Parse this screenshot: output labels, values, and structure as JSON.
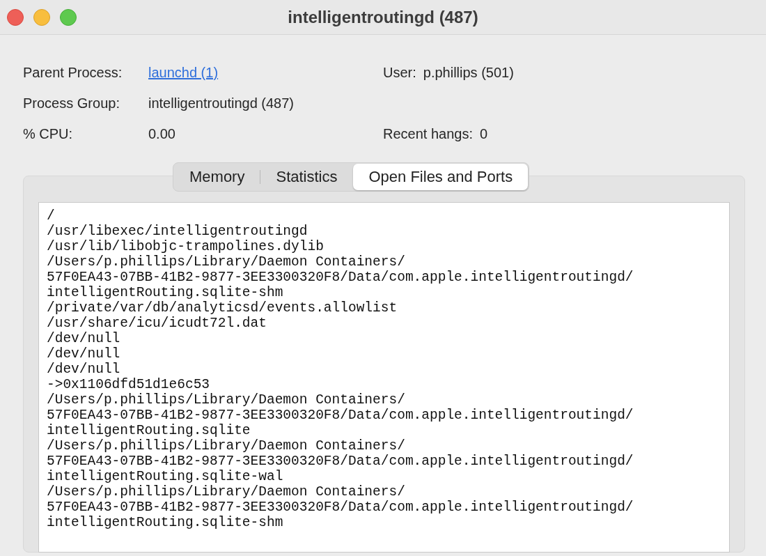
{
  "window": {
    "title": "intelligentroutingd (487)"
  },
  "info": [
    {
      "label": "Parent Process:",
      "value": "launchd (1)",
      "kind": "link"
    },
    {
      "label": "User:",
      "value": "p.phillips (501)",
      "kind": "text"
    },
    {
      "label": "Process Group:",
      "value": "intelligentroutingd (487)",
      "kind": "text"
    },
    {
      "label": "% CPU:",
      "value": "0.00",
      "kind": "text"
    },
    {
      "label": "Recent hangs:",
      "value": "0",
      "kind": "text"
    }
  ],
  "tabs": [
    {
      "label": "Memory",
      "selected": false
    },
    {
      "label": "Statistics",
      "selected": false
    },
    {
      "label": "Open Files and Ports",
      "selected": true
    }
  ],
  "open_files": [
    "/",
    "/usr/libexec/intelligentroutingd",
    "/usr/lib/libobjc-trampolines.dylib",
    "/Users/p.phillips/Library/Daemon Containers/",
    "57F0EA43-07BB-41B2-9877-3EE3300320F8/Data/com.apple.intelligentroutingd/",
    "intelligentRouting.sqlite-shm",
    "/private/var/db/analyticsd/events.allowlist",
    "/usr/share/icu/icudt72l.dat",
    "/dev/null",
    "/dev/null",
    "/dev/null",
    "->0x1106dfd51d1e6c53",
    "/Users/p.phillips/Library/Daemon Containers/",
    "57F0EA43-07BB-41B2-9877-3EE3300320F8/Data/com.apple.intelligentroutingd/",
    "intelligentRouting.sqlite",
    "/Users/p.phillips/Library/Daemon Containers/",
    "57F0EA43-07BB-41B2-9877-3EE3300320F8/Data/com.apple.intelligentroutingd/",
    "intelligentRouting.sqlite-wal",
    "/Users/p.phillips/Library/Daemon Containers/",
    "57F0EA43-07BB-41B2-9877-3EE3300320F8/Data/com.apple.intelligentroutingd/",
    "intelligentRouting.sqlite-shm"
  ]
}
